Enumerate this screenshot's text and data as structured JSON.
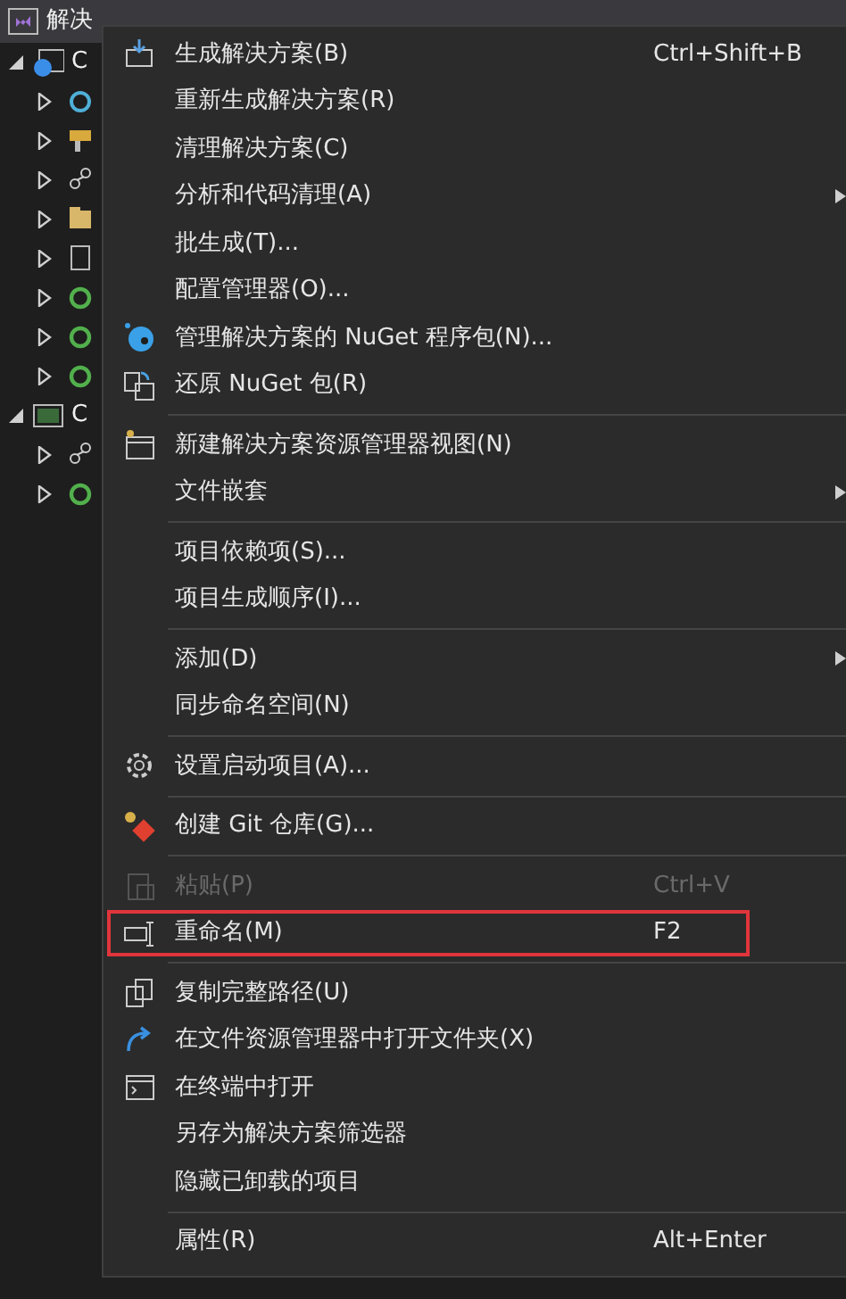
{
  "solution": {
    "label": "解决",
    "children": [
      {
        "label": "C",
        "expanded": true,
        "children": [
          {
            "expanded": false
          },
          {
            "expanded": false
          },
          {
            "expanded": false
          },
          {
            "expanded": false
          },
          {
            "expanded": false
          },
          {
            "expanded": false
          },
          {
            "expanded": false
          },
          {
            "expanded": false
          }
        ]
      },
      {
        "label": "C",
        "expanded": true,
        "children": [
          {
            "expanded": false
          },
          {
            "expanded": false
          }
        ]
      }
    ]
  },
  "context_menu": {
    "items": [
      {
        "kind": "item",
        "label": "生成解决方案(B)",
        "shortcut": "Ctrl+Shift+B",
        "submenu": false,
        "disabled": false,
        "highlighted": false
      },
      {
        "kind": "item",
        "label": "重新生成解决方案(R)",
        "submenu": false,
        "disabled": false,
        "highlighted": false
      },
      {
        "kind": "item",
        "label": "清理解决方案(C)",
        "submenu": false,
        "disabled": false,
        "highlighted": false
      },
      {
        "kind": "item",
        "label": "分析和代码清理(A)",
        "submenu": true,
        "disabled": false,
        "highlighted": false
      },
      {
        "kind": "item",
        "label": "批生成(T)...",
        "submenu": false,
        "disabled": false,
        "highlighted": false
      },
      {
        "kind": "item",
        "label": "配置管理器(O)...",
        "submenu": false,
        "disabled": false,
        "highlighted": false
      },
      {
        "kind": "item",
        "label": "管理解决方案的 NuGet 程序包(N)...",
        "submenu": false,
        "disabled": false,
        "highlighted": false
      },
      {
        "kind": "item",
        "label": "还原 NuGet 包(R)",
        "submenu": false,
        "disabled": false,
        "highlighted": false
      },
      {
        "kind": "separator"
      },
      {
        "kind": "item",
        "label": "新建解决方案资源管理器视图(N)",
        "submenu": false,
        "disabled": false,
        "highlighted": false
      },
      {
        "kind": "item",
        "label": "文件嵌套",
        "submenu": true,
        "disabled": false,
        "highlighted": false
      },
      {
        "kind": "separator"
      },
      {
        "kind": "item",
        "label": "项目依赖项(S)...",
        "submenu": false,
        "disabled": false,
        "highlighted": false
      },
      {
        "kind": "item",
        "label": "项目生成顺序(I)...",
        "submenu": false,
        "disabled": false,
        "highlighted": false
      },
      {
        "kind": "separator"
      },
      {
        "kind": "item",
        "label": "添加(D)",
        "submenu": true,
        "disabled": false,
        "highlighted": false
      },
      {
        "kind": "item",
        "label": "同步命名空间(N)",
        "submenu": false,
        "disabled": false,
        "highlighted": false
      },
      {
        "kind": "separator"
      },
      {
        "kind": "item",
        "label": "设置启动项目(A)...",
        "submenu": false,
        "disabled": false,
        "highlighted": false
      },
      {
        "kind": "separator"
      },
      {
        "kind": "item",
        "label": "创建 Git 仓库(G)...",
        "submenu": false,
        "disabled": false,
        "highlighted": false
      },
      {
        "kind": "separator"
      },
      {
        "kind": "item",
        "label": "粘贴(P)",
        "shortcut": "Ctrl+V",
        "submenu": false,
        "disabled": true,
        "highlighted": false
      },
      {
        "kind": "item",
        "label": "重命名(M)",
        "shortcut": "F2",
        "submenu": false,
        "disabled": false,
        "highlighted": true
      },
      {
        "kind": "separator"
      },
      {
        "kind": "item",
        "label": "复制完整路径(U)",
        "submenu": false,
        "disabled": false,
        "highlighted": false
      },
      {
        "kind": "item",
        "label": "在文件资源管理器中打开文件夹(X)",
        "submenu": false,
        "disabled": false,
        "highlighted": false
      },
      {
        "kind": "item",
        "label": "在终端中打开",
        "submenu": false,
        "disabled": false,
        "highlighted": false
      },
      {
        "kind": "item",
        "label": "另存为解决方案筛选器",
        "submenu": false,
        "disabled": false,
        "highlighted": false
      },
      {
        "kind": "item",
        "label": "隐藏已卸载的项目",
        "submenu": false,
        "disabled": false,
        "highlighted": false
      },
      {
        "kind": "separator"
      },
      {
        "kind": "item",
        "label": "属性(R)",
        "shortcut": "Alt+Enter",
        "submenu": false,
        "disabled": false,
        "highlighted": false
      }
    ]
  }
}
